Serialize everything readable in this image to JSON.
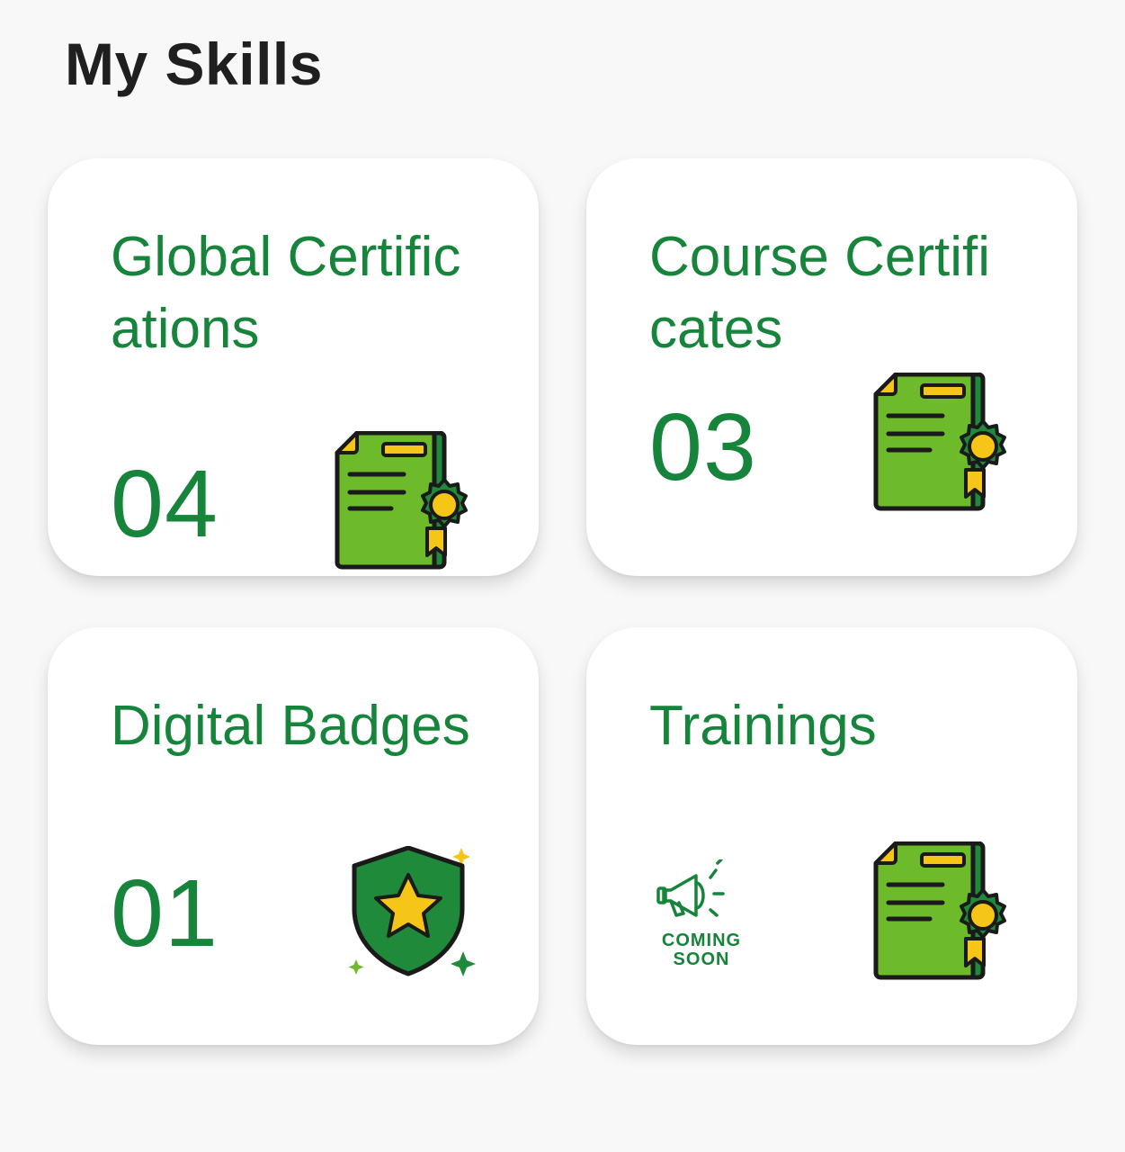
{
  "page": {
    "title": "My Skills"
  },
  "colors": {
    "title": "#1f1f1f",
    "accent_green": "#16843a",
    "icon_green": "#6dbb2b",
    "icon_dark_green": "#1e8a3a",
    "icon_gold": "#f5c518",
    "card_background": "#ffffff",
    "page_background": "#f8f8f8"
  },
  "cards": [
    {
      "title": "Global Certifications",
      "count": "04",
      "icon": "certificate-icon"
    },
    {
      "title": "Course Certificates",
      "count": "03",
      "icon": "certificate-icon"
    },
    {
      "title": "Digital Badges",
      "count": "01",
      "icon": "shield-star-icon"
    },
    {
      "title": "Trainings",
      "icon": "certificate-icon",
      "coming_soon": {
        "line1": "COMING",
        "line2": "SOON",
        "icon": "megaphone-icon"
      }
    }
  ]
}
